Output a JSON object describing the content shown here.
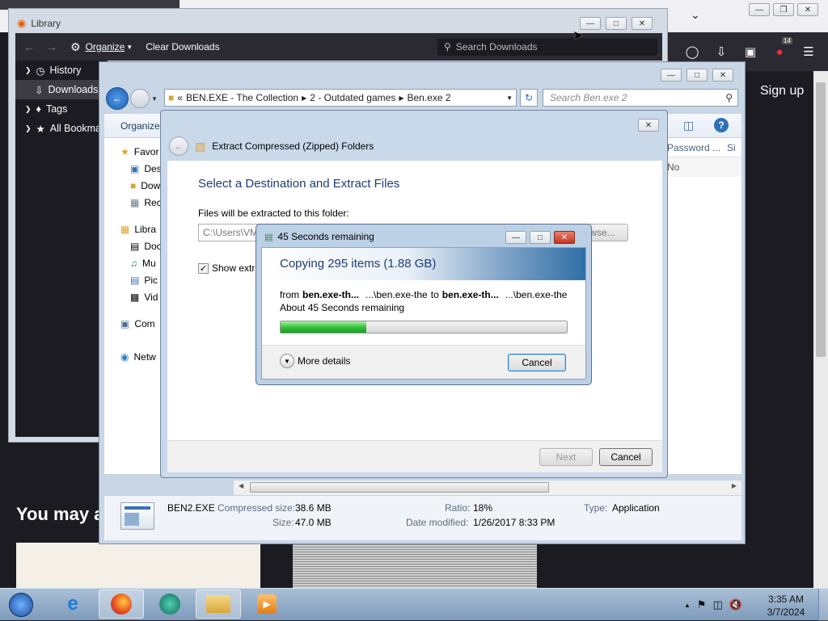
{
  "firefox": {
    "sign_up": "Sign up",
    "you_may": "You may a"
  },
  "library": {
    "title": "Library",
    "organize": "Organize",
    "clear_downloads": "Clear Downloads",
    "search_placeholder": "Search Downloads",
    "sidebar": [
      "History",
      "Downloads",
      "Tags",
      "All Bookma"
    ]
  },
  "explorer": {
    "breadcrumb": [
      "BEN.EXE - The Collection",
      "2 - Outdated games",
      "Ben.exe 2"
    ],
    "breadcrumb_prefix": "«",
    "search_placeholder": "Search Ben.exe 2",
    "organize": "Organize",
    "nav": [
      {
        "label": "Favor",
        "icon": "star-icon"
      },
      {
        "label": "Des",
        "icon": "desktop-icon"
      },
      {
        "label": "Dow",
        "icon": "folder-icon"
      },
      {
        "label": "Rec",
        "icon": "recent-icon"
      },
      {
        "label": "Libra",
        "icon": "library-icon"
      },
      {
        "label": "Doc",
        "icon": "document-icon"
      },
      {
        "label": "Mu",
        "icon": "music-icon"
      },
      {
        "label": "Pic",
        "icon": "picture-icon"
      },
      {
        "label": "Vid",
        "icon": "video-icon"
      },
      {
        "label": "Com",
        "icon": "computer-icon"
      },
      {
        "label": "Netw",
        "icon": "network-icon"
      }
    ],
    "column_password": "Password ...",
    "column_size": "Si",
    "row_value": "No",
    "status": {
      "file_name": "BEN2.EXE",
      "compressed_label": "Compressed size:",
      "compressed_value": "38.6 MB",
      "size_label": "Size:",
      "size_value": "47.0 MB",
      "ratio_label": "Ratio:",
      "ratio_value": "18%",
      "date_label": "Date modified:",
      "date_value": "1/26/2017 8:33 PM",
      "type_label": "Type:",
      "type_value": "Application"
    }
  },
  "wizard": {
    "title": "Extract Compressed (Zipped) Folders",
    "heading": "Select a Destination and Extract Files",
    "folder_label": "Files will be extracted to this folder:",
    "folder_value": "C:\\Users\\VM",
    "browse": "wse...",
    "show_extracted": "Show extra",
    "next": "Next",
    "cancel": "Cancel"
  },
  "copy": {
    "title": "45 Seconds remaining",
    "heading": "Copying 295 items (1.88 GB)",
    "from_label": "from",
    "from_name": "ben.exe-th...",
    "from_path": "...\\ben.exe-the",
    "to_label": "to",
    "to_name": "ben.exe-th...",
    "to_path": "...\\ben.exe-the",
    "remaining": "About 45 Seconds remaining",
    "progress": 0.3,
    "more_details": "More details",
    "cancel": "Cancel"
  },
  "taskbar": {
    "time": "3:35 AM",
    "date": "3/7/2024"
  }
}
